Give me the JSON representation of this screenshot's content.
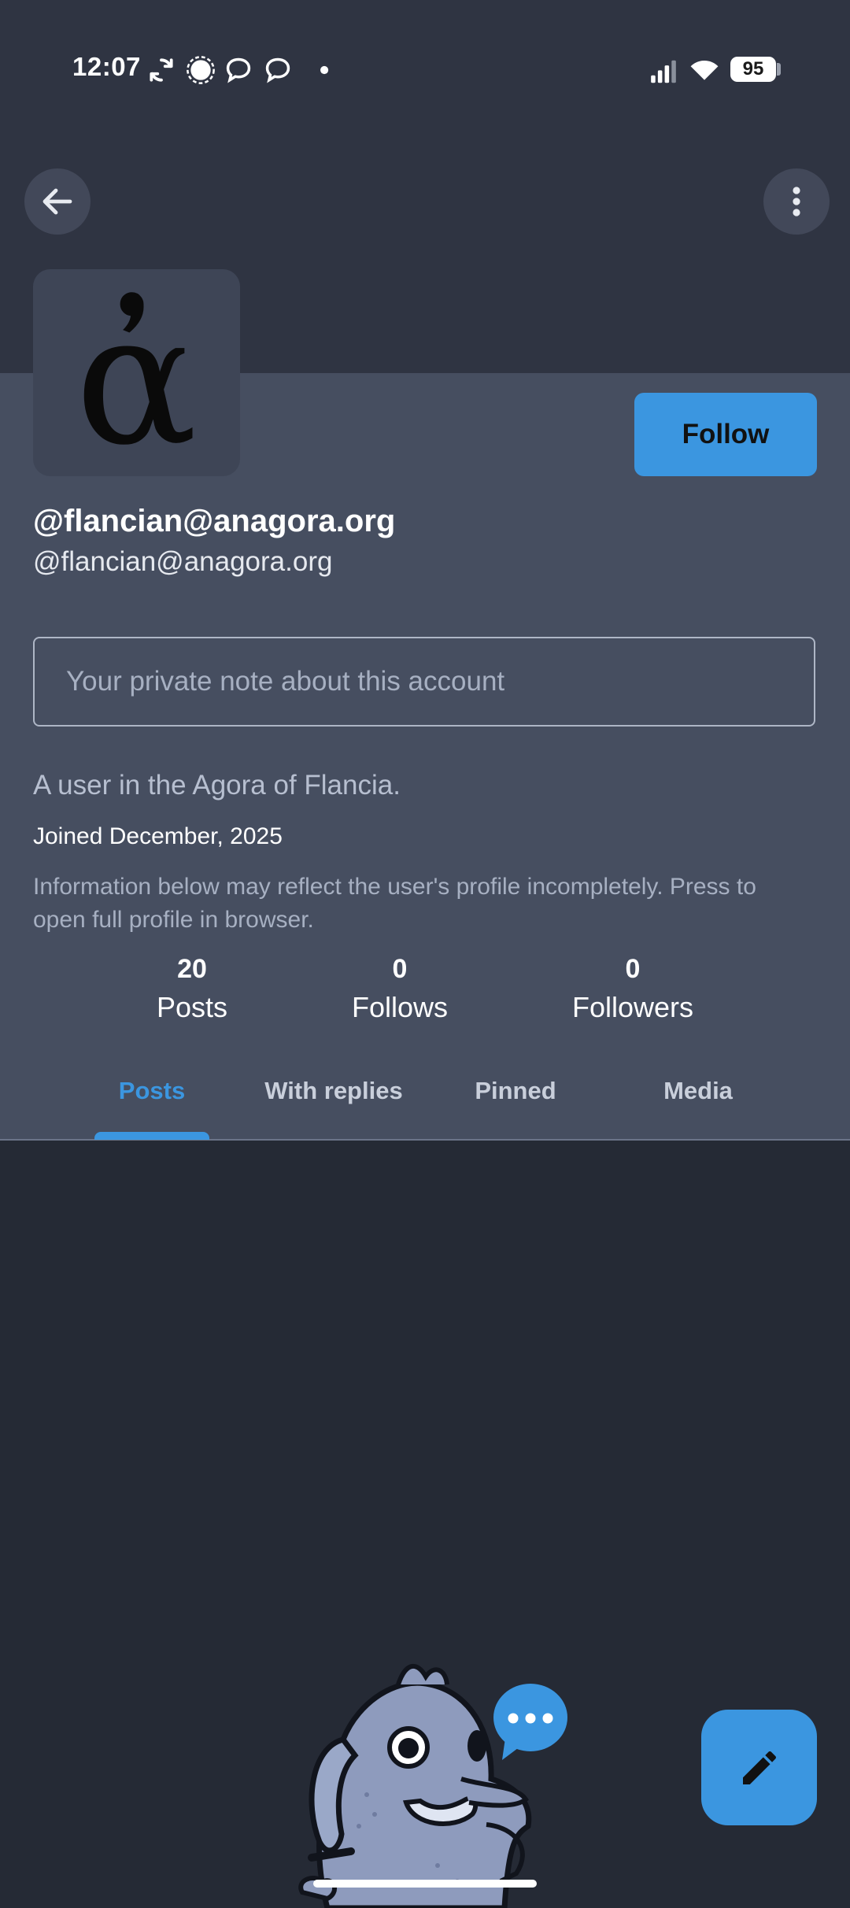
{
  "status_bar": {
    "time": "12:07",
    "battery": "95",
    "icons": [
      "sync-icon",
      "signal-messenger-icon",
      "chat-bubble-icon",
      "chat-bubble-icon",
      "dot-icon",
      "cell-signal-icon",
      "wifi-icon",
      "battery-icon"
    ]
  },
  "header": {
    "back_icon": "arrow-left-icon",
    "more_icon": "more-vertical-icon"
  },
  "profile": {
    "avatar_glyph": "ἀ",
    "display_name": "@flancian@anagora.org",
    "handle": "@flancian@anagora.org",
    "follow_label": "Follow",
    "private_note_placeholder": "Your private note about this account",
    "bio": "A user in the Agora of Flancia.",
    "joined": "Joined December, 2025",
    "info_note": "Information below may reflect the user's profile incompletely. Press to open full profile in browser."
  },
  "stats": {
    "posts": {
      "value": "20",
      "label": "Posts"
    },
    "follows": {
      "value": "0",
      "label": "Follows"
    },
    "followers": {
      "value": "0",
      "label": "Followers"
    }
  },
  "tabs": {
    "items": [
      {
        "label": "Posts",
        "active": true
      },
      {
        "label": "With replies",
        "active": false
      },
      {
        "label": "Pinned",
        "active": false
      },
      {
        "label": "Media",
        "active": false
      }
    ]
  },
  "fab": {
    "icon": "pencil-icon"
  },
  "colors": {
    "accent": "#3b96e0",
    "header_bg": "#2f3442",
    "card_bg": "#464e60",
    "feed_bg": "#252a35"
  }
}
